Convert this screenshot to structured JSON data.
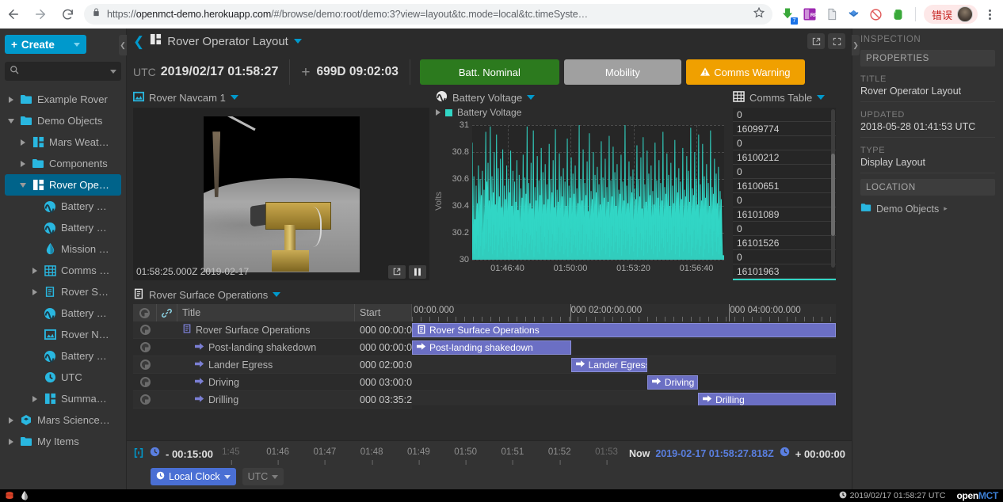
{
  "browser": {
    "url_bold": "openmct-demo.herokuapp.com",
    "url_prefix": "https://",
    "url_suffix": "/#/browse/demo:root/demo:3?view=layout&tc.mode=local&tc.timeSyste…",
    "error_badge": "错误",
    "icons": [
      "back-icon",
      "forward-icon",
      "reload-icon",
      "lock-icon",
      "star-icon",
      "download-icon",
      "rp-extension-icon",
      "page-extension-icon",
      "diamond-extension-icon",
      "block-extension-icon",
      "evernote-extension-icon",
      "kebab-menu-icon"
    ]
  },
  "sidebar": {
    "create_label": "Create",
    "search_placeholder": "",
    "tree": [
      {
        "label": "Example Rover",
        "icon": "folder-icon",
        "indent": 0,
        "twisty": "right",
        "selected": false
      },
      {
        "label": "Demo Objects",
        "icon": "folder-icon",
        "indent": 0,
        "twisty": "down",
        "selected": false
      },
      {
        "label": "Mars Weat…",
        "icon": "layout-icon",
        "indent": 1,
        "twisty": "right",
        "selected": false
      },
      {
        "label": "Components",
        "icon": "folder-icon",
        "indent": 1,
        "twisty": "right",
        "selected": false
      },
      {
        "label": "Rover Ope…",
        "icon": "layout-icon",
        "indent": 1,
        "twisty": "down",
        "selected": true
      },
      {
        "label": "Battery …",
        "icon": "telemetry-icon",
        "indent": 2,
        "twisty": "none",
        "selected": false
      },
      {
        "label": "Battery …",
        "icon": "telemetry-icon",
        "indent": 2,
        "twisty": "none",
        "selected": false
      },
      {
        "label": "Mission …",
        "icon": "droplet-icon",
        "indent": 2,
        "twisty": "none",
        "selected": false
      },
      {
        "label": "Comms …",
        "icon": "table-icon",
        "indent": 2,
        "twisty": "right",
        "selected": false
      },
      {
        "label": "Rover S…",
        "icon": "plan-icon",
        "indent": 2,
        "twisty": "right",
        "selected": false
      },
      {
        "label": "Battery …",
        "icon": "telemetry-icon",
        "indent": 2,
        "twisty": "none",
        "selected": false
      },
      {
        "label": "Rover N…",
        "icon": "image-icon",
        "indent": 2,
        "twisty": "none",
        "selected": false
      },
      {
        "label": "Battery …",
        "icon": "telemetry-icon",
        "indent": 2,
        "twisty": "none",
        "selected": false
      },
      {
        "label": "UTC",
        "icon": "clock-icon",
        "indent": 2,
        "twisty": "none",
        "selected": false
      },
      {
        "label": "Summa…",
        "icon": "layout-icon",
        "indent": 2,
        "twisty": "right",
        "selected": false
      },
      {
        "label": "Mars Science…",
        "icon": "hexagon-icon",
        "indent": 0,
        "twisty": "right",
        "selected": false
      },
      {
        "label": "My Items",
        "icon": "folder-icon",
        "indent": 0,
        "twisty": "right",
        "selected": false
      }
    ]
  },
  "header": {
    "title": "Rover Operator Layout",
    "back_icon": "back-chevron-icon",
    "object_icon": "layout-icon",
    "actions": [
      "export-icon",
      "fullscreen-icon"
    ]
  },
  "statusrow": {
    "clock_label": "UTC",
    "clock_value": "2019/02/17 01:58:27",
    "plus_symbol": "+",
    "elapsed": "699D 09:02:03",
    "pills": [
      {
        "label": "Batt. Nominal",
        "color": "#2c7a1e",
        "width": 176,
        "warn": false
      },
      {
        "label": "Mobility",
        "color": "#a0a0a0",
        "width": 148,
        "warn": false
      },
      {
        "label": "Comms Warning",
        "color": "#f0a000",
        "width": 150,
        "warn": true
      }
    ]
  },
  "navcam": {
    "title": "Rover Navcam 1",
    "timestamp": "01:58:25.000Z 2019-02-17",
    "buttons": [
      "export-icon",
      "pause-icon"
    ]
  },
  "comms_table": {
    "title": "Comms Table",
    "rows": [
      "0",
      "16099774",
      "0",
      "16100212",
      "0",
      "16100651",
      "0",
      "16101089",
      "0",
      "16101526",
      "0",
      "16101963",
      "0"
    ]
  },
  "timeline": {
    "title": "Rover Surface Operations",
    "columns": [
      "Title",
      "Start"
    ],
    "rows": [
      {
        "title": "Rover Surface Operations",
        "start": "000 00:00:0(",
        "icon": "plan-icon"
      },
      {
        "title": "Post-landing shakedown",
        "start": "000 00:00:0(",
        "icon": "activity-icon"
      },
      {
        "title": "Lander Egress",
        "start": "000 02:00:0(",
        "icon": "activity-icon"
      },
      {
        "title": "Driving",
        "start": "000 03:00:0(",
        "icon": "activity-icon"
      },
      {
        "title": "Drilling",
        "start": "000 03:35:2·",
        "icon": "activity-icon"
      }
    ],
    "ruler_labels": [
      "00:00.000",
      "000 02:00:00.000",
      "000 04:00:00.000"
    ],
    "bars": [
      {
        "label": "Rover Surface Operations",
        "left": 0,
        "width": 100,
        "icon": "plan-icon"
      },
      {
        "label": "Post-landing shakedown",
        "left": 0,
        "width": 37.5,
        "icon": "activity-icon"
      },
      {
        "label": "Lander Egress",
        "left": 37.5,
        "width": 18,
        "icon": "activity-icon"
      },
      {
        "label": "Driving",
        "left": 55.5,
        "width": 12,
        "icon": "activity-icon"
      },
      {
        "label": "Drilling",
        "left": 67.5,
        "width": 32.5,
        "icon": "activity-icon"
      }
    ]
  },
  "conductor": {
    "start_offset": "- 00:15:00",
    "end_offset": "+ 00:00:00",
    "now_label": "Now",
    "now_value": "2019-02-17 01:58:27.818Z",
    "ticks": [
      "1:45",
      "01:46",
      "01:47",
      "01:48",
      "01:49",
      "01:50",
      "01:51",
      "01:52",
      "01:53"
    ],
    "mode_label": "Local Clock",
    "timezone_label": "UTC"
  },
  "inspector": {
    "heading": "INSPECTION",
    "properties_label": "PROPERTIES",
    "fields": [
      {
        "key": "TITLE",
        "value": "Rover Operator Layout"
      },
      {
        "key": "UPDATED",
        "value": "2018-05-28 01:41:53 UTC"
      },
      {
        "key": "TYPE",
        "value": "Display Layout"
      }
    ],
    "location_label": "LOCATION",
    "location_value": "Demo Objects"
  },
  "statusbar": {
    "time": "2019/02/17 01:58:27 UTC",
    "logo_white": "open",
    "logo_blue": "MCT"
  },
  "chart_data": {
    "type": "line",
    "title": "Battery Voltage",
    "legend": [
      "Battery Voltage"
    ],
    "legend_position": "top-left",
    "series_color": "#31d6c5",
    "ylabel": "Volts",
    "xlabel": "",
    "ylim": [
      30,
      31
    ],
    "yticks": [
      30,
      30.2,
      30.4,
      30.6,
      30.8,
      31
    ],
    "ytick_labels": [
      "30",
      "30.2",
      "30.4",
      "30.6",
      "30.8",
      "31"
    ],
    "xtick_labels": [
      "01:46:40",
      "01:50:00",
      "01:53:20",
      "01:56:40"
    ],
    "grid": true,
    "values": [
      30.87,
      30.05,
      30.2,
      30.62,
      30.04,
      30.3,
      30.12,
      30.55,
      30.08,
      30.42,
      30.18,
      30.7,
      30.02,
      30.35,
      30.6,
      30.1,
      30.48,
      30.25,
      30.66,
      30.03,
      30.15,
      30.52,
      30.08,
      30.38,
      30.95,
      30.12,
      30.58,
      30.3,
      30.72,
      30.06,
      30.44,
      30.2,
      30.99,
      30.1,
      30.35,
      30.62,
      30.04,
      30.5,
      30.26,
      30.8,
      30.07,
      30.41,
      30.18,
      30.93,
      30.02,
      30.33,
      30.68,
      30.11,
      30.47,
      30.22,
      30.75,
      30.05,
      30.39,
      30.16,
      30.82,
      30.09,
      30.29,
      30.55,
      30.03,
      30.45,
      30.21,
      30.7,
      30.13,
      30.36,
      30.6,
      30.02,
      30.5,
      30.24,
      30.81,
      30.06,
      30.4,
      30.17,
      30.66,
      30.1,
      30.32,
      30.58,
      30.04,
      30.43,
      30.19,
      30.74,
      30.08,
      30.37,
      30.14,
      30.63,
      30.01,
      30.28,
      30.53,
      30.11,
      30.46,
      30.23,
      30.78,
      30.05,
      30.34,
      30.61,
      30.09,
      30.49,
      30.2,
      30.99,
      30.03,
      30.31,
      30.57,
      30.12,
      30.42,
      30.18,
      30.72,
      30.07,
      30.38,
      30.15,
      30.96,
      30.02,
      30.27,
      30.54,
      30.1,
      30.44,
      30.21,
      30.77,
      30.06,
      30.35,
      30.59,
      30.04,
      30.48,
      30.25,
      30.83,
      30.13,
      30.3,
      30.65,
      30.08,
      30.41,
      30.17,
      30.71,
      30.02,
      30.36,
      30.56,
      30.11,
      30.45,
      30.22,
      30.86,
      30.05,
      30.33,
      30.6,
      30.09,
      30.5,
      30.19,
      30.74,
      30.07,
      30.39,
      30.14,
      30.97,
      30.03,
      30.29,
      30.52,
      30.12,
      30.43,
      30.24,
      30.79,
      30.06,
      30.37,
      30.62,
      30.1,
      30.47,
      30.2,
      30.68,
      30.04,
      30.32,
      30.58,
      30.08,
      30.4,
      30.16,
      30.9,
      30.02,
      30.28,
      30.55,
      30.13,
      30.46,
      30.23,
      30.76,
      30.05,
      30.34,
      30.64,
      30.11,
      30.49,
      30.18,
      30.7,
      30.09,
      30.31,
      30.53,
      30.03,
      30.42,
      30.21,
      31.0,
      30.07,
      30.38,
      30.6,
      30.12,
      30.44,
      30.26,
      30.82,
      30.04,
      30.3,
      30.57,
      30.1,
      30.48,
      30.19,
      30.73,
      30.06,
      30.36,
      30.15,
      30.94,
      30.02,
      30.27,
      30.51,
      30.13,
      30.45,
      30.22,
      30.8,
      30.08,
      30.33,
      30.63,
      30.05,
      30.5,
      30.17,
      30.69,
      30.11,
      30.29,
      30.56,
      30.03,
      30.41,
      30.24,
      30.88,
      30.07,
      30.35,
      30.61,
      30.09,
      30.46,
      30.2,
      30.75,
      30.04,
      30.31,
      30.54,
      30.12,
      30.43,
      30.16,
      30.92,
      30.02,
      30.28,
      30.59,
      30.1,
      30.47,
      30.25,
      30.84,
      30.06,
      30.37,
      30.65,
      30.13,
      30.4,
      30.18,
      30.71,
      30.05,
      30.32,
      30.52,
      30.09,
      30.49,
      30.23,
      30.78,
      30.03,
      30.34,
      30.58,
      30.11,
      30.44,
      30.21,
      31.01,
      30.08,
      30.3,
      30.55,
      30.14,
      30.42,
      30.19,
      30.73,
      30.04,
      30.36,
      30.62,
      30.1,
      30.5,
      30.17,
      30.67,
      30.06,
      30.29,
      30.53,
      30.12,
      30.45,
      30.24,
      30.85,
      30.02,
      30.33,
      30.6,
      30.09,
      30.47,
      30.2,
      30.76,
      30.07,
      30.38,
      30.15,
      30.91,
      30.03,
      30.27,
      30.56,
      30.13,
      30.43,
      30.22,
      30.81,
      30.05,
      30.35,
      30.64,
      30.11,
      30.48,
      30.18,
      30.7,
      30.08,
      30.31,
      30.51,
      30.04,
      30.41,
      30.26,
      30.87,
      30.1,
      30.37,
      30.59,
      30.02,
      30.46,
      30.21,
      30.74,
      30.06,
      30.32,
      30.57,
      30.12,
      30.44,
      30.16,
      30.95,
      30.09,
      30.28,
      30.54,
      30.03,
      30.49,
      30.23,
      30.79,
      30.13,
      30.39,
      30.63,
      30.05,
      30.4,
      30.19,
      30.72,
      30.07,
      30.3,
      30.55,
      30.11,
      30.42,
      30.25,
      30.89,
      30.04,
      30.34,
      30.61,
      30.1,
      30.5,
      30.17,
      30.68,
      30.02,
      30.36,
      30.58,
      30.12,
      30.45,
      30.2,
      30.83,
      30.06,
      30.29,
      30.52,
      30.08,
      30.47,
      30.24,
      30.77,
      30.13,
      30.33,
      30.66,
      30.05,
      30.43,
      30.18,
      30.98,
      30.03,
      30.31,
      30.53,
      30.09,
      30.48,
      30.22,
      30.8,
      30.07,
      30.35,
      30.6,
      30.11,
      30.41,
      30.15,
      30.93,
      30.04,
      30.27,
      30.56,
      30.1,
      30.44,
      30.26,
      30.86,
      30.02,
      30.38,
      30.62,
      30.08,
      30.46,
      30.19,
      30.71,
      30.12,
      30.32,
      30.57,
      30.05,
      30.4,
      30.23,
      30.96,
      30.09,
      30.3,
      30.54,
      30.03,
      30.49,
      30.21,
      30.75,
      30.13,
      30.37,
      30.64,
      30.06,
      30.42,
      30.17,
      30.69,
      30.04,
      30.28,
      30.51,
      30.1,
      30.45,
      30.2,
      30.03,
      30.03,
      30.03,
      30.03
    ]
  }
}
